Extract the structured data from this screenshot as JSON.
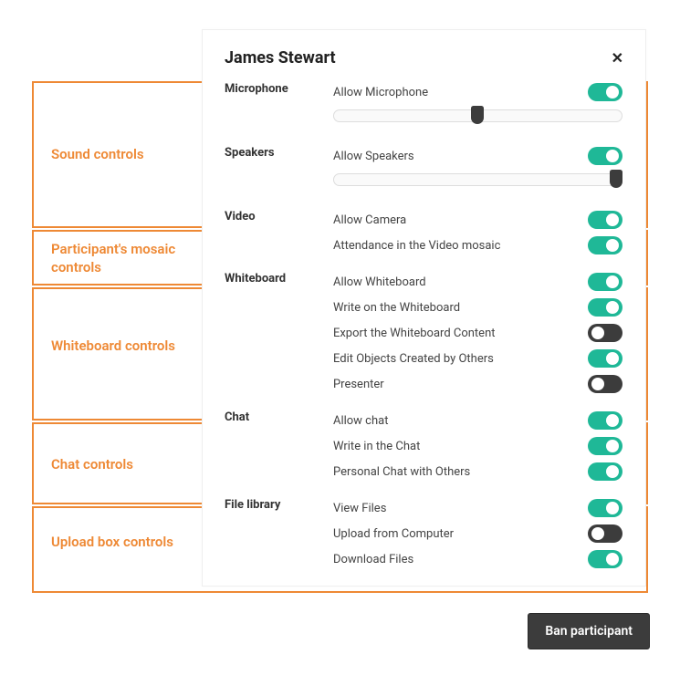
{
  "header": {
    "title": "James Stewart",
    "close": "✕"
  },
  "sections": {
    "sound": {
      "title": "Sound controls"
    },
    "mosaic": {
      "title": "Participant's mosaic controls"
    },
    "wb": {
      "title": "Whiteboard controls"
    },
    "chat": {
      "title": "Chat controls"
    },
    "upload": {
      "title": "Upload box controls"
    }
  },
  "mic": {
    "heading": "Microphone",
    "allow": {
      "label": "Allow Microphone",
      "on": true
    },
    "level": 50
  },
  "spk": {
    "heading": "Speakers",
    "allow": {
      "label": "Allow Speakers",
      "on": true
    },
    "level": 98
  },
  "video": {
    "heading": "Video",
    "allow": {
      "label": "Allow Camera",
      "on": true
    },
    "mosaic": {
      "label": "Attendance in the Video mosaic",
      "on": true
    }
  },
  "wb": {
    "heading": "Whiteboard",
    "allow": {
      "label": "Allow Whiteboard",
      "on": true
    },
    "write": {
      "label": "Write on the Whiteboard",
      "on": true
    },
    "export": {
      "label": "Export the Whiteboard Content",
      "on": false
    },
    "editoth": {
      "label": "Edit Objects Created by Others",
      "on": true
    },
    "present": {
      "label": "Presenter",
      "on": false
    }
  },
  "chat": {
    "heading": "Chat",
    "allow": {
      "label": "Allow chat",
      "on": true
    },
    "write": {
      "label": "Write in the Chat",
      "on": true
    },
    "personal": {
      "label": "Personal Chat with Others",
      "on": true
    }
  },
  "file": {
    "heading": "File library",
    "view": {
      "label": "View Files",
      "on": true
    },
    "upload": {
      "label": "Upload from Computer",
      "on": false
    },
    "down": {
      "label": "Download Files",
      "on": true
    }
  },
  "ban": {
    "label": "Ban participant"
  }
}
